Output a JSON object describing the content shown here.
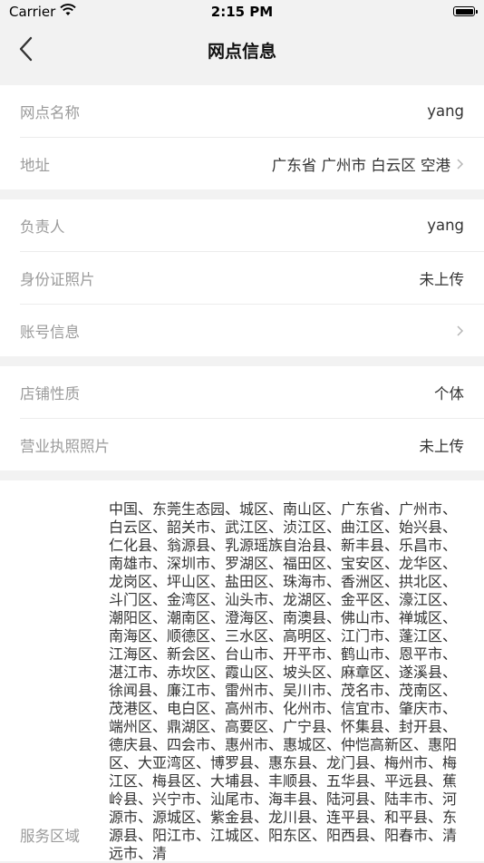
{
  "status_bar": {
    "carrier": "Carrier",
    "time": "2:15 PM"
  },
  "nav": {
    "title": "网点信息"
  },
  "group1": {
    "rows": [
      {
        "label": "网点名称",
        "value": "yang"
      },
      {
        "label": "地址",
        "value": "广东省 广州市 白云区 空港"
      }
    ]
  },
  "group2": {
    "rows": [
      {
        "label": "负责人",
        "value": "yang"
      },
      {
        "label": "身份证照片",
        "value": "未上传"
      },
      {
        "label": "账号信息",
        "value": ""
      }
    ]
  },
  "group3": {
    "rows": [
      {
        "label": "店铺性质",
        "value": "个体"
      },
      {
        "label": "营业执照照片",
        "value": "未上传"
      }
    ]
  },
  "service": {
    "label": "服务区域",
    "text": "中国、东莞生态园、城区、南山区、广东省、广州市、白云区、韶关市、武江区、浈江区、曲江区、始兴县、仁化县、翁源县、乳源瑶族自治县、新丰县、乐昌市、南雄市、深圳市、罗湖区、福田区、宝安区、龙华区、龙岗区、坪山区、盐田区、珠海市、香洲区、拱北区、斗门区、金湾区、汕头市、龙湖区、金平区、濠江区、潮阳区、潮南区、澄海区、南澳县、佛山市、禅城区、南海区、顺德区、三水区、高明区、江门市、蓬江区、江海区、新会区、台山市、开平市、鹤山市、恩平市、湛江市、赤坎区、霞山区、坡头区、麻章区、遂溪县、徐闻县、廉江市、雷州市、吴川市、茂名市、茂南区、茂港区、电白区、高州市、化州市、信宜市、肇庆市、端州区、鼎湖区、高要区、广宁县、怀集县、封开县、德庆县、四会市、惠州市、惠城区、仲恺高新区、惠阳区、大亚湾区、博罗县、惠东县、龙门县、梅州市、梅江区、梅县区、大埔县、丰顺县、五华县、平远县、蕉岭县、兴宁市、汕尾市、海丰县、陆河县、陆丰市、河源市、源城区、紫金县、龙川县、连平县、和平县、东源县、阳江市、江城区、阳东区、阳西县、阳春市、清远市、清"
  }
}
